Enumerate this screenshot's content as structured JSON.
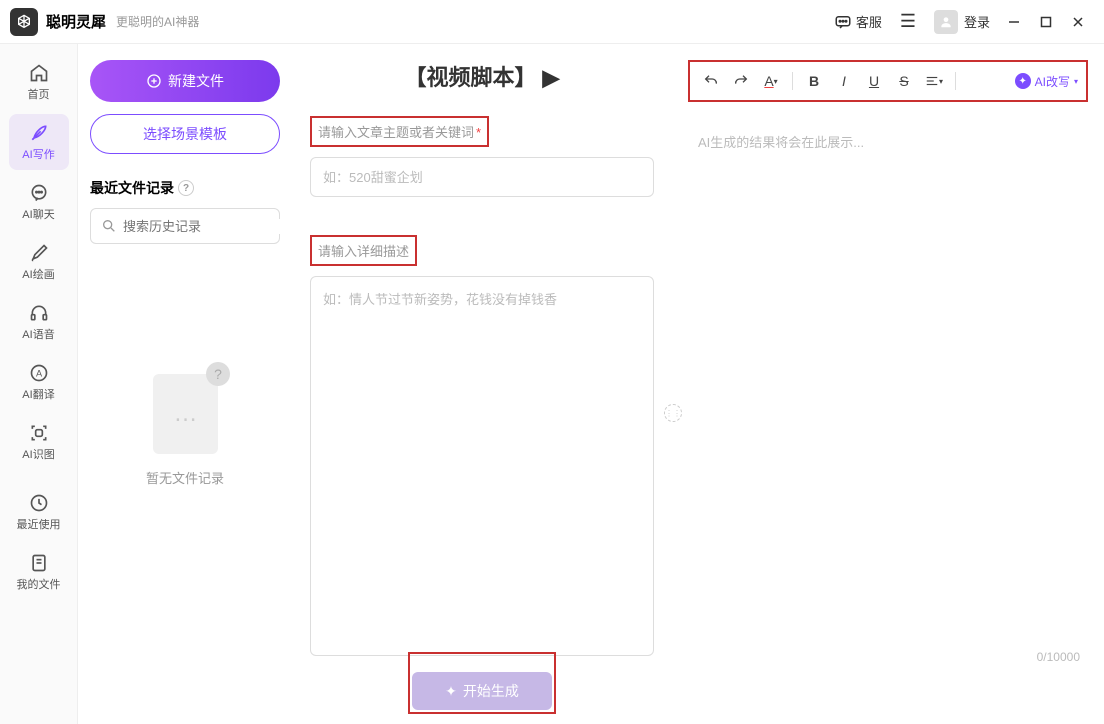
{
  "app": {
    "title": "聪明灵犀",
    "subtitle": "更聪明的AI神器"
  },
  "titlebar": {
    "kefu_label": "客服",
    "login_label": "登录"
  },
  "sidebar": {
    "items": [
      {
        "label": "首页",
        "icon": "home"
      },
      {
        "label": "AI写作",
        "icon": "feather"
      },
      {
        "label": "AI聊天",
        "icon": "chat"
      },
      {
        "label": "AI绘画",
        "icon": "brush"
      },
      {
        "label": "AI语音",
        "icon": "headphone"
      },
      {
        "label": "AI翻译",
        "icon": "translate"
      },
      {
        "label": "AI识图",
        "icon": "scan"
      },
      {
        "label": "最近使用",
        "icon": "clock"
      },
      {
        "label": "我的文件",
        "icon": "file"
      }
    ]
  },
  "leftPanel": {
    "new_file_label": "新建文件",
    "scene_template_label": "选择场景模板",
    "recent_files_label": "最近文件记录",
    "search_placeholder": "搜索历史记录",
    "empty_text": "暂无文件记录"
  },
  "midPanel": {
    "title": "【视频脚本】",
    "subject_label": "请输入文章主题或者关键词",
    "subject_placeholder": "如：520甜蜜企划",
    "detail_label": "请输入详细描述",
    "detail_placeholder": "如：情人节过节新姿势，花钱没有掉钱香",
    "generate_label": "开始生成"
  },
  "rightPanel": {
    "ai_rewrite_label": "AI改写",
    "result_placeholder": "AI生成的结果将会在此展示...",
    "char_count": "0/10000"
  }
}
